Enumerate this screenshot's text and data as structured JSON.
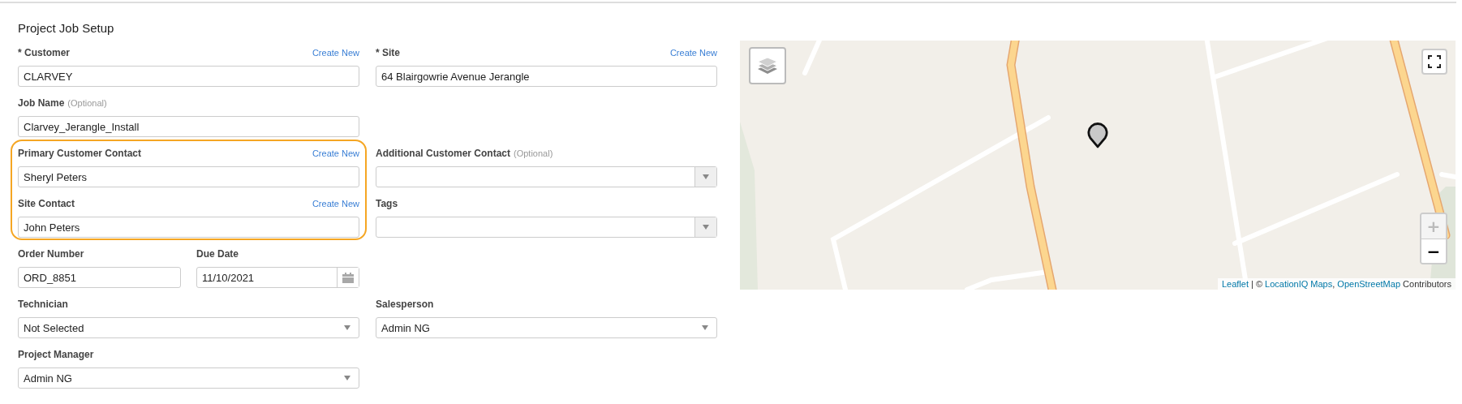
{
  "title": "Project Job Setup",
  "rows": [
    {
      "left": [
        {
          "label": "* Customer",
          "create_new": "Create New",
          "kind": "text",
          "value": "CLARVEY"
        }
      ],
      "right": [
        {
          "label": "* Site",
          "create_new": "Create New",
          "kind": "text",
          "value": "64 Blairgowrie Avenue Jerangle"
        }
      ]
    },
    {
      "left": [
        {
          "label": "Job Name",
          "note": "(Optional)",
          "kind": "text",
          "value": "Clarvey_Jerangle_Install"
        }
      ]
    },
    {
      "left": [
        {
          "label": "Primary Customer Contact",
          "create_new": "Create New",
          "kind": "text",
          "value": "Sheryl Peters",
          "highlighted": true
        }
      ],
      "right": [
        {
          "label": "Additional Customer Contact",
          "note": "(Optional)",
          "kind": "combo"
        }
      ]
    },
    {
      "left": [
        {
          "label": "Site Contact",
          "create_new": "Create New",
          "kind": "text",
          "value": "John Peters",
          "highlighted": true
        }
      ],
      "right": [
        {
          "label": "Tags",
          "kind": "combo"
        }
      ]
    },
    {
      "left": [
        {
          "label": "Order Number",
          "kind": "text",
          "value": "ORD_8851"
        },
        {
          "label": "Due Date",
          "kind": "date",
          "value": "11/10/2021"
        }
      ]
    },
    {
      "left": [
        {
          "label": "Technician",
          "kind": "select",
          "value": "Not Selected"
        }
      ],
      "right": [
        {
          "label": "Salesperson",
          "kind": "select",
          "value": "Admin NG"
        }
      ]
    },
    {
      "left": [
        {
          "label": "Project Manager",
          "kind": "select",
          "value": "Admin NG"
        }
      ]
    }
  ],
  "map": {
    "kind": "picture",
    "zoom": [
      {
        "label": "+",
        "disabled": true
      },
      {
        "label": "−",
        "disabled": false
      }
    ],
    "attribution": [
      {
        "text": "Leaflet",
        "link": true
      },
      {
        "text": " | © ",
        "link": false
      },
      {
        "text": "LocationIQ Maps",
        "link": true
      },
      {
        "text": ", ",
        "link": false
      },
      {
        "text": "OpenStreetMap",
        "link": true
      },
      {
        "text": " Contributors",
        "link": false
      }
    ]
  }
}
